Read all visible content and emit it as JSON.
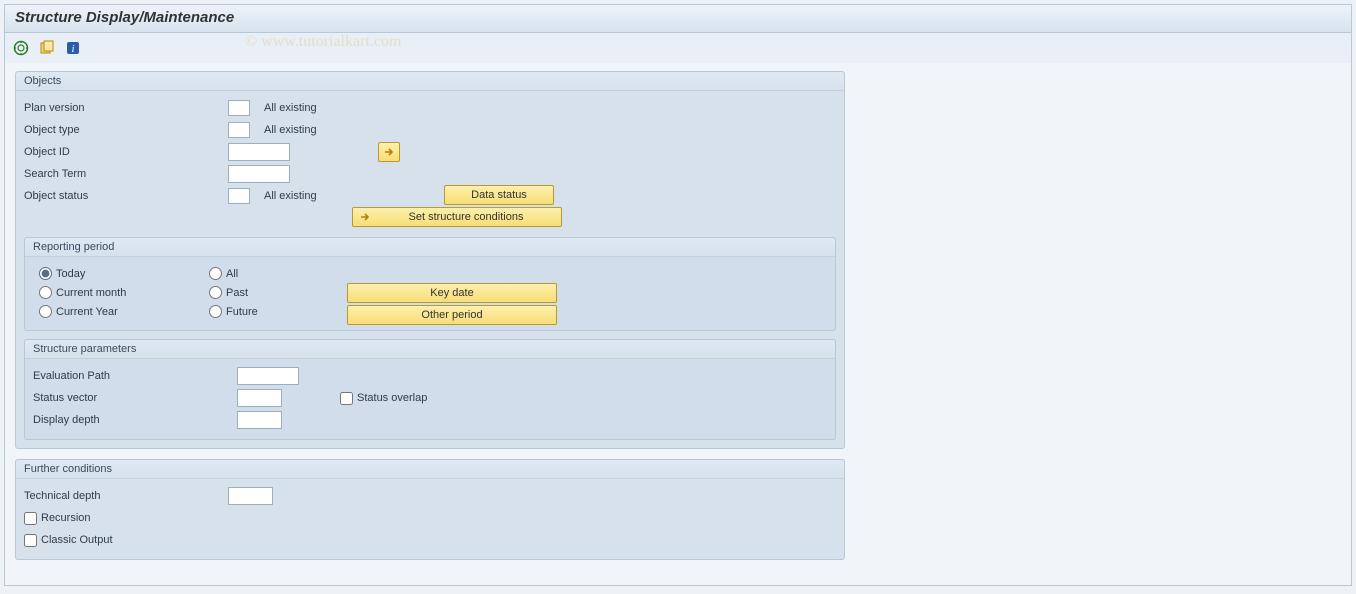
{
  "header": {
    "title": "Structure Display/Maintenance"
  },
  "watermark": "© www.tutorialkart.com",
  "toolbar": {
    "icons": {
      "execute": "execute-icon",
      "variant": "variant-icon",
      "info": "info-icon"
    }
  },
  "objects": {
    "title": "Objects",
    "plan_version": {
      "label": "Plan version",
      "value": "",
      "desc": "All existing"
    },
    "object_type": {
      "label": "Object type",
      "value": "",
      "desc": "All existing"
    },
    "object_id": {
      "label": "Object ID",
      "value": ""
    },
    "search_term": {
      "label": "Search Term",
      "value": ""
    },
    "object_status": {
      "label": "Object status",
      "value": "",
      "desc": "All existing"
    },
    "buttons": {
      "data_status": "Data status",
      "set_structure": "Set structure conditions"
    }
  },
  "reporting": {
    "title": "Reporting period",
    "options_left": {
      "today": "Today",
      "current_month": "Current month",
      "current_year": "Current Year"
    },
    "options_right": {
      "all": "All",
      "past": "Past",
      "future": "Future"
    },
    "selected": "today",
    "buttons": {
      "key_date": "Key date",
      "other_period": "Other period"
    }
  },
  "structure_params": {
    "title": "Structure parameters",
    "evaluation_path": {
      "label": "Evaluation Path",
      "value": ""
    },
    "status_vector": {
      "label": "Status vector",
      "value": ""
    },
    "display_depth": {
      "label": "Display depth",
      "value": ""
    },
    "status_overlap": {
      "label": "Status overlap",
      "checked": false
    }
  },
  "further": {
    "title": "Further conditions",
    "technical_depth": {
      "label": "Technical depth",
      "value": ""
    },
    "recursion": {
      "label": "Recursion",
      "checked": false
    },
    "classic_output": {
      "label": "Classic Output",
      "checked": false
    }
  }
}
